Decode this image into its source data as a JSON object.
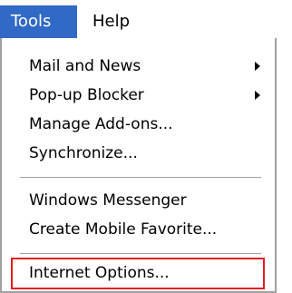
{
  "menubar": {
    "tools_label": "Tools",
    "help_label": "Help"
  },
  "menu": {
    "group1": [
      {
        "label": "Mail and News",
        "has_submenu": true
      },
      {
        "label": "Pop-up Blocker",
        "has_submenu": true
      },
      {
        "label": "Manage Add-ons...",
        "has_submenu": false
      },
      {
        "label": "Synchronize...",
        "has_submenu": false
      }
    ],
    "group2": [
      {
        "label": "Windows Messenger",
        "has_submenu": false
      },
      {
        "label": "Create Mobile Favorite...",
        "has_submenu": false
      }
    ],
    "group3": [
      {
        "label": "Internet Options...",
        "has_submenu": false,
        "highlighted": true
      }
    ]
  },
  "colors": {
    "active_menu_bg": "#3169c6",
    "highlight_border": "#e31b23",
    "border": "#a0a0a0"
  }
}
